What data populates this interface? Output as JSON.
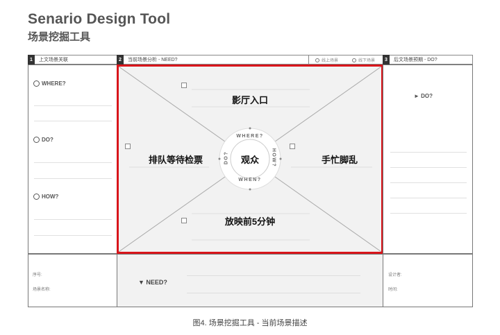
{
  "header": {
    "title": "Senario Design Tool",
    "subtitle": "场景挖掘工具"
  },
  "columns": {
    "col1": {
      "number": "1",
      "label": "上文场景关联"
    },
    "col2": {
      "number": "2",
      "label": "当前场景分析 - NEED?",
      "option_online": "线上场景",
      "option_offline": "线下场景"
    },
    "col3": {
      "number": "3",
      "label": "后文场景预期 - DO?"
    }
  },
  "left_panel": {
    "where": "WHERE?",
    "do": "DO?",
    "how": "HOW?"
  },
  "center_panel": {
    "top": "影厅入口",
    "left": "排队等待检票",
    "right": "手忙脚乱",
    "bottom": "放映前5分钟",
    "core": "观众",
    "ring": {
      "top": "WHERE?",
      "right": "HOW?",
      "bottom": "WHEN?",
      "left": "DO?"
    }
  },
  "right_panel": {
    "do": "► DO?"
  },
  "bottom": {
    "serial_label": "序号:",
    "scene_name_label": "场景名称:",
    "need": "▼ NEED?",
    "designer_label": "设计者:",
    "time_label": "时间:"
  },
  "caption": "图4. 场景挖掘工具 - 当前场景描述",
  "colors": {
    "highlight": "#d9151b",
    "panel_fill": "#f2f2f2",
    "header_dark": "#333333"
  }
}
